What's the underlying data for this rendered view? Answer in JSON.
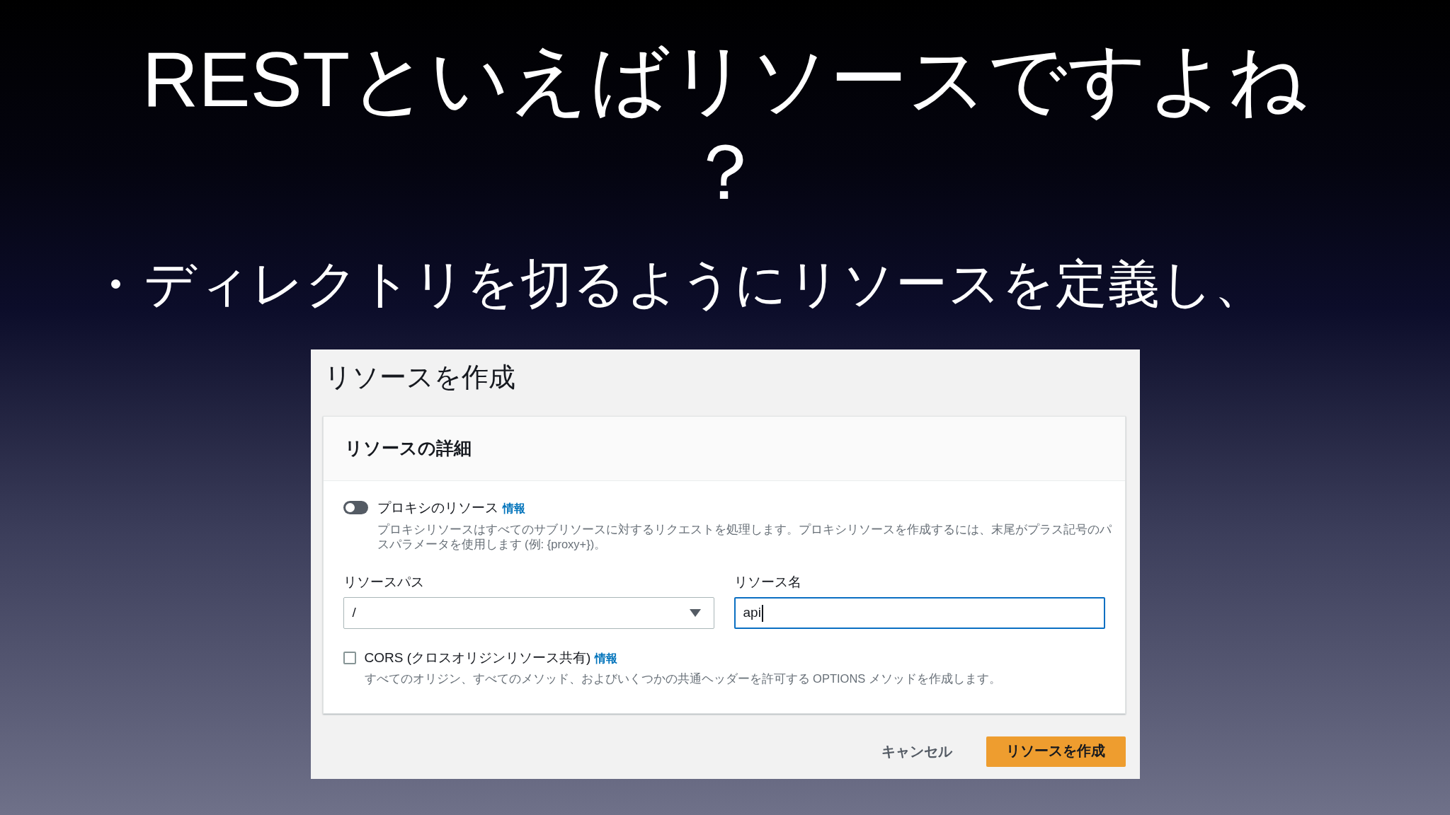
{
  "slide": {
    "title": "RESTといえばリソースですよね？",
    "bullets": [
      {
        "text": "ディレクトリを切るようにリソースを定義し、"
      }
    ]
  },
  "dialog": {
    "title": "リソースを作成",
    "section": {
      "title": "リソースの詳細",
      "proxy_toggle": {
        "label": "プロキシのリソース",
        "info_link": "情報",
        "on": false,
        "description": "プロキシリソースはすべてのサブリソースに対するリクエストを処理します。プロキシリソースを作成するには、末尾がプラス記号のパスパラメータを使用します (例: {proxy+})。"
      },
      "fields": [
        {
          "kind": "select",
          "label": "リソースパス",
          "value": "/",
          "focused": false
        },
        {
          "kind": "text",
          "label": "リソース名",
          "value": "api",
          "focused": true
        }
      ],
      "cors_checkbox": {
        "label": "CORS (クロスオリジンリソース共有)",
        "info_link": "情報",
        "checked": false,
        "description": "すべてのオリジン、すべてのメソッド、およびいくつかの共通ヘッダーを許可する OPTIONS メソッドを作成します。"
      }
    },
    "buttons": [
      {
        "kind": "link",
        "label": "キャンセル"
      },
      {
        "kind": "primary",
        "label": "リソースを作成"
      }
    ]
  }
}
